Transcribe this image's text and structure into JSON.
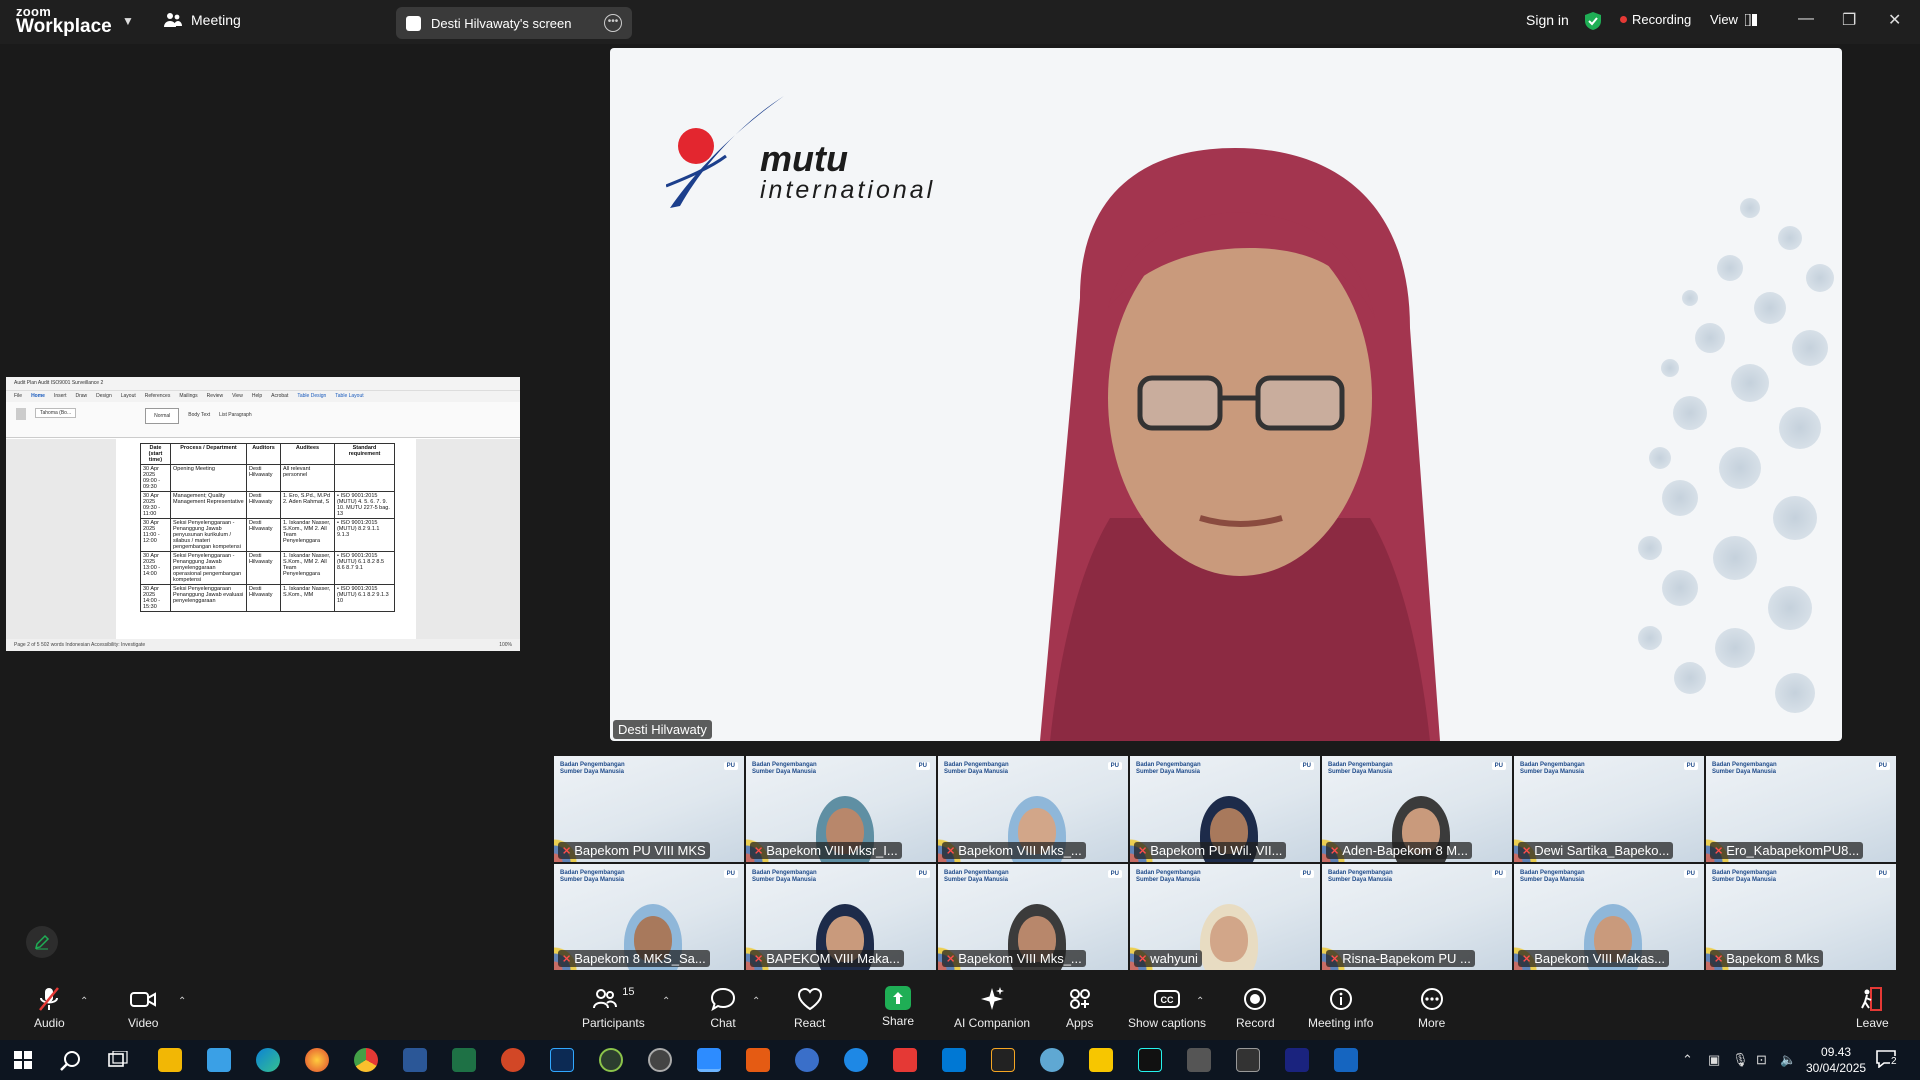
{
  "app": {
    "logo_line1": "zoom",
    "logo_line2": "Workplace",
    "meeting_label": "Meeting",
    "screen_pill": "Desti Hilvawaty's screen",
    "sign_in": "Sign in",
    "recording": "Recording",
    "view": "View"
  },
  "shared_doc": {
    "title": "Audit Plan Audit ISO9001 Surveillance 2",
    "tabs": [
      "File",
      "Home",
      "Insert",
      "Draw",
      "Design",
      "Layout",
      "References",
      "Mailings",
      "Review",
      "View",
      "Help",
      "Acrobat",
      "Table Design",
      "Table Layout"
    ],
    "styles": [
      "Normal",
      "Body Text",
      "List Paragraph"
    ],
    "font": "Tahoma (Bo...",
    "table_headers": [
      "Date (start time)",
      "Process / Department",
      "Auditors",
      "Auditees",
      "Standard requirement"
    ],
    "rows": [
      [
        "30 Apr 2025 09:00 - 09:30",
        "Opening Meeting",
        "Desti Hilvawaty",
        "All relevant personnel",
        ""
      ],
      [
        "30 Apr 2025 09:30 - 11:00",
        "Management; Quality Management Representative",
        "Desti Hilvawaty",
        "1. Ero, S.Pd., M.Pd  2. Aden Rahmat, S",
        "• ISO 9001:2015 (MUTU) 4. 5. 6. 7. 9. 10.  MUTU 227-5 bag. 13"
      ],
      [
        "30 Apr 2025 11:00 - 12:00",
        "Seksi Penyelenggaraan - Penanggung Jawab penyusunan kurikulum / silabus / materi pengembangan kompetensi",
        "Desti Hilvawaty",
        "1. Iskandar Nasser, S.Kom., MM  2. All Team Penyelenggara",
        "• ISO 9001:2015 (MUTU) 8.2 9.1.1 9.1.3"
      ],
      [
        "30 Apr 2025 13:00 - 14:00",
        "Seksi Penyelenggaraan - Penanggung Jawab penyelenggaraan operasional pengembangan kompetensi",
        "Desti Hilvawaty",
        "1. Iskandar Nasser, S.Kom., MM  2. All Team Penyelenggara",
        "• ISO 9001:2015 (MUTU) 6.1 8.2 8.5 8.6 8.7 9.1"
      ],
      [
        "30 Apr 2025 14:00 - 15:30",
        "Seksi Penyelenggaraan Penanggung Jawab evaluasi penyelenggaraan",
        "Desti Hilvawaty",
        "1. Iskandar Nasser, S.Kom., MM",
        "• ISO 9001:2015 (MUTU) 6.1 8.2 9.1.3 10"
      ]
    ],
    "status": "Page 2 of 5   502 words   Indonesian   Accessibility: Investigate",
    "zoom_level": "100%"
  },
  "speaker": {
    "name": "Desti Hilvawaty",
    "brand_line1": "mutu",
    "brand_line2": "international"
  },
  "gallery": [
    {
      "name": "Bapekom PU VIII MKS",
      "has_face": false
    },
    {
      "name": "Bapekom VIII Mksr_I...",
      "has_face": true
    },
    {
      "name": "Bapekom VIII Mks_...",
      "has_face": true
    },
    {
      "name": "Bapekom PU Wil. VII...",
      "has_face": true
    },
    {
      "name": "Aden-Bapekom 8 M...",
      "has_face": true
    },
    {
      "name": "Dewi Sartika_Bapeko...",
      "has_face": false
    },
    {
      "name": "Ero_KabapekomPU8...",
      "has_face": false
    },
    {
      "name": "Bapekom 8 MKS_Sa...",
      "has_face": true
    },
    {
      "name": "BAPEKOM VIII Maka...",
      "has_face": true
    },
    {
      "name": "Bapekom VIII Mks_...",
      "has_face": true
    },
    {
      "name": "wahyuni",
      "has_face": true
    },
    {
      "name": "Risna-Bapekom PU ...",
      "has_face": false
    },
    {
      "name": "Bapekom VIII Makas...",
      "has_face": true
    },
    {
      "name": "Bapekom 8 Mks",
      "has_face": false
    }
  ],
  "tile_brand": {
    "bpsdm": "Badan Pengembangan Sumber Daya Manusia",
    "pu": "PU"
  },
  "toolbar": {
    "audio": "Audio",
    "video": "Video",
    "participants": "Participants",
    "participants_count": "15",
    "chat": "Chat",
    "react": "React",
    "share": "Share",
    "ai": "AI Companion",
    "apps": "Apps",
    "captions": "Show captions",
    "record": "Record",
    "info": "Meeting info",
    "more": "More",
    "leave": "Leave"
  },
  "taskbar": {
    "time": "09.43",
    "date": "30/04/2025",
    "notifications": "2"
  },
  "colors": {
    "accent_green": "#1fae55",
    "recording_red": "#e53935",
    "hijab": "#a3354f",
    "brand_blue": "#1c3f8c",
    "brand_red": "#e3262f"
  }
}
